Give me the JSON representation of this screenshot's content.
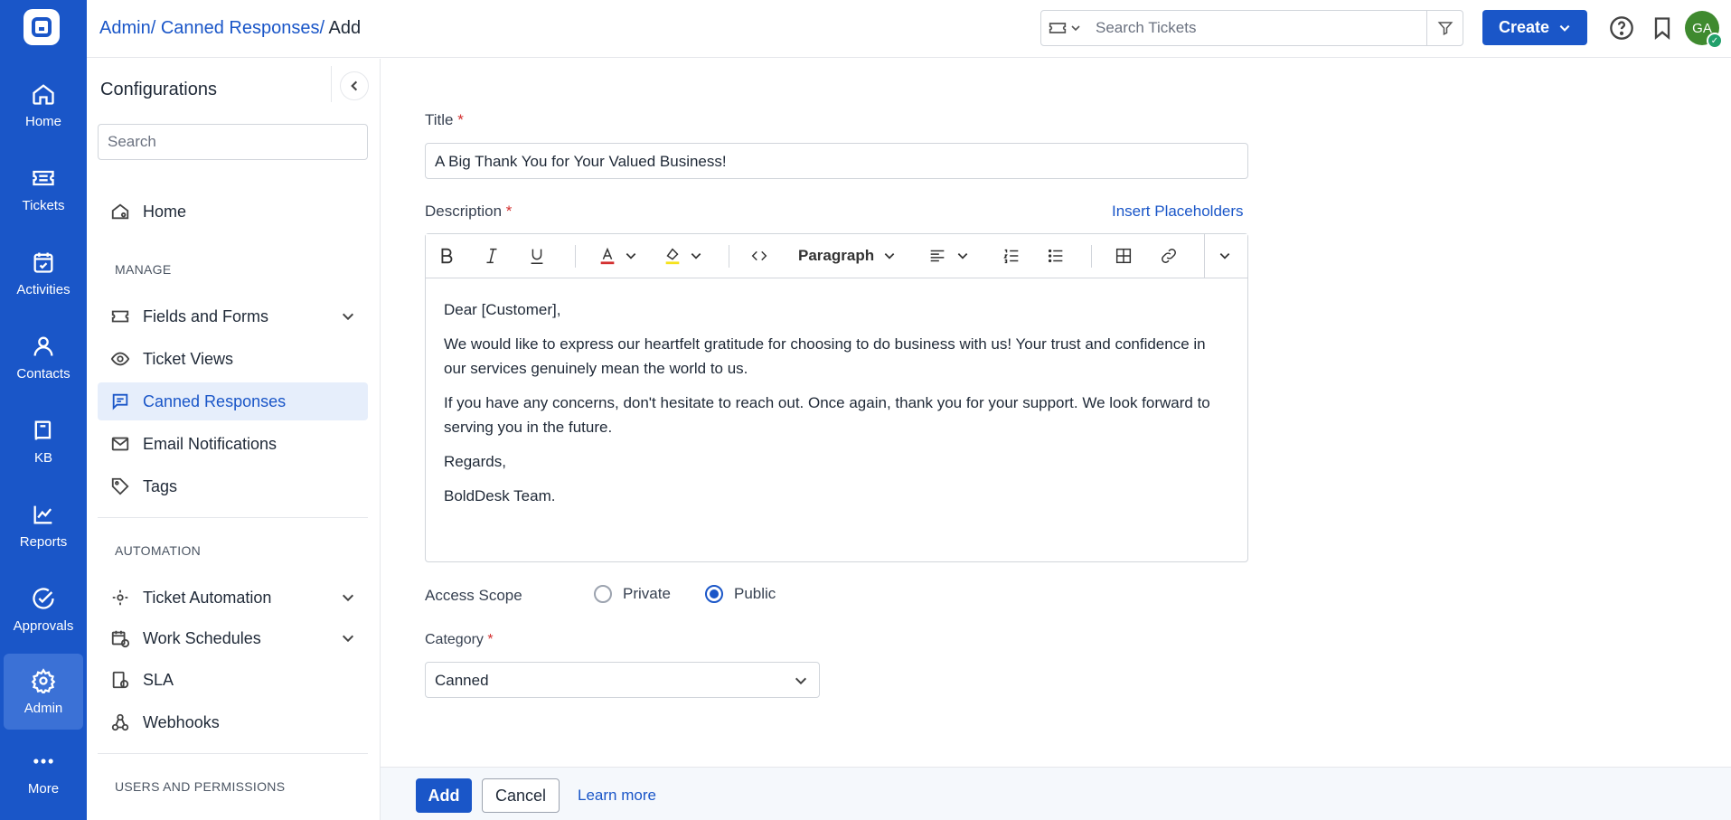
{
  "rail": {
    "items": [
      {
        "label": "Home",
        "icon": "home-icon"
      },
      {
        "label": "Tickets",
        "icon": "ticket-icon"
      },
      {
        "label": "Activities",
        "icon": "calendar-check-icon"
      },
      {
        "label": "Contacts",
        "icon": "user-icon"
      },
      {
        "label": "KB",
        "icon": "book-icon"
      },
      {
        "label": "Reports",
        "icon": "chart-icon"
      },
      {
        "label": "Approvals",
        "icon": "check-circle-icon"
      },
      {
        "label": "Admin",
        "icon": "gear-icon"
      },
      {
        "label": "More",
        "icon": "more-dots-icon"
      }
    ],
    "active": "Admin",
    "accent": "#1a56c8"
  },
  "header": {
    "crumb_admin": "Admin/",
    "crumb_canned": "Canned Responses/",
    "crumb_add": "Add",
    "search_placeholder": "Search Tickets",
    "create_label": "Create",
    "avatar_initials": "GA"
  },
  "config": {
    "title": "Configurations",
    "search_placeholder": "Search",
    "home": "Home",
    "manage_section": "MANAGE",
    "fields_forms": "Fields and Forms",
    "ticket_views": "Ticket Views",
    "canned_responses": "Canned Responses",
    "email_notifications": "Email Notifications",
    "tags": "Tags",
    "automation_section": "AUTOMATION",
    "ticket_automation": "Ticket Automation",
    "work_schedules": "Work Schedules",
    "sla": "SLA",
    "webhooks": "Webhooks",
    "users_section": "USERS AND PERMISSIONS"
  },
  "form": {
    "title_label": "Title",
    "title_value": "A Big Thank You for Your Valued Business!",
    "description_label": "Description",
    "insert_placeholders": "Insert Placeholders",
    "paragraph_format": "Paragraph",
    "body": [
      "Dear [Customer],",
      "We would like to express our heartfelt gratitude for choosing to do business with us! Your trust and confidence in our services genuinely mean the world to us.",
      "If you have any concerns, don't hesitate to reach out. Once again, thank you for your support. We look forward to serving you in the future.",
      "Regards,",
      "BoldDesk Team."
    ],
    "access_scope_label": "Access Scope",
    "access_private": "Private",
    "access_public": "Public",
    "access_selected": "Public",
    "category_label": "Category",
    "category_value": "Canned",
    "required_mark": "*"
  },
  "footer": {
    "add_label": "Add",
    "cancel_label": "Cancel",
    "learn_more": "Learn more"
  }
}
